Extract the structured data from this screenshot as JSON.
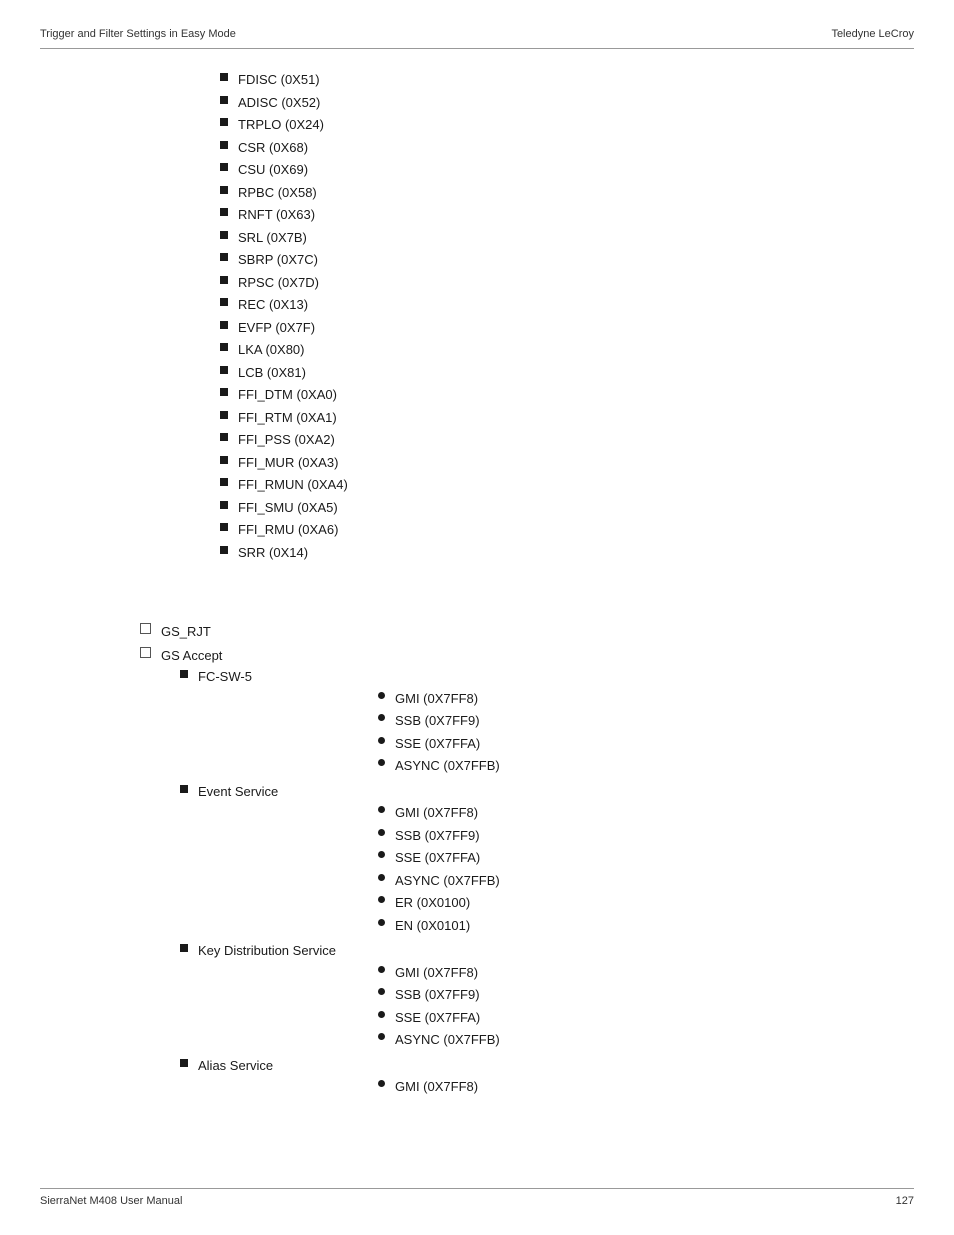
{
  "header": {
    "left": "Trigger and Filter Settings in Easy Mode",
    "right": "Teledyne LeCroy"
  },
  "footer": {
    "left": "SierraNet M408 User Manual",
    "right": "127"
  },
  "top_list": {
    "items": [
      "FDISC (0X51)",
      "ADISC (0X52)",
      "TRPLO (0X24)",
      "CSR (0X68)",
      "CSU (0X69)",
      "RPBC (0X58)",
      "RNFT (0X63)",
      "SRL (0X7B)",
      "SBRP (0X7C)",
      "RPSC (0X7D)",
      "REC (0X13)",
      "EVFP (0X7F)",
      "LKA (0X80)",
      "LCB (0X81)",
      "FFI_DTM (0XA0)",
      "FFI_RTM (0XA1)",
      "FFI_PSS (0XA2)",
      "FFI_MUR (0XA3)",
      "FFI_RMUN (0XA4)",
      "FFI_SMU (0XA5)",
      "FFI_RMU (0XA6)",
      "SRR (0X14)"
    ]
  },
  "bottom_list": {
    "gs_rjt": "GS_RJT",
    "gs_accept": "GS Accept",
    "fc_sw5": {
      "label": "FC-SW-5",
      "items": [
        "GMI (0X7FF8)",
        "SSB (0X7FF9)",
        "SSE (0X7FFA)",
        "ASYNC (0X7FFB)"
      ]
    },
    "event_service": {
      "label": "Event Service",
      "items": [
        "GMI (0X7FF8)",
        "SSB (0X7FF9)",
        "SSE (0X7FFA)",
        "ASYNC (0X7FFB)",
        "ER (0X0100)",
        "EN (0X0101)"
      ]
    },
    "key_distribution": {
      "label": "Key Distribution Service",
      "items": [
        "GMI (0X7FF8)",
        "SSB (0X7FF9)",
        "SSE (0X7FFA)",
        "ASYNC (0X7FFB)"
      ]
    },
    "alias_service": {
      "label": "Alias Service",
      "items": [
        "GMI (0X7FF8)"
      ]
    }
  }
}
